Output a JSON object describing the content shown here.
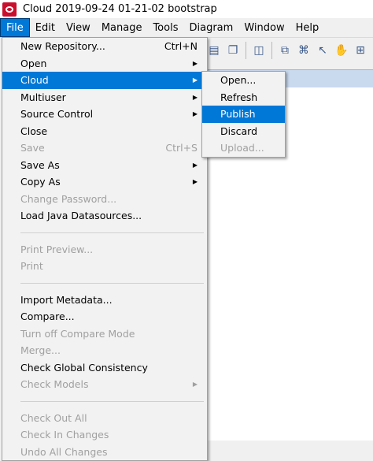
{
  "window": {
    "title": "Cloud 2019-09-24 01-21-02 bootstrap"
  },
  "menubar": {
    "items": [
      "File",
      "Edit",
      "View",
      "Manage",
      "Tools",
      "Diagram",
      "Window",
      "Help"
    ]
  },
  "file_menu": {
    "new_repository": {
      "label": "New Repository...",
      "shortcut": "Ctrl+N"
    },
    "open": "Open",
    "cloud": "Cloud",
    "multiuser": "Multiuser",
    "source_control": "Source Control",
    "close": "Close",
    "save": {
      "label": "Save",
      "shortcut": "Ctrl+S"
    },
    "save_as": "Save As",
    "copy_as": "Copy As",
    "change_password": "Change Password...",
    "load_java": "Load Java Datasources...",
    "print_preview": "Print Preview...",
    "print": "Print",
    "import_metadata": "Import Metadata...",
    "compare": "Compare...",
    "turn_off_compare": "Turn off Compare Mode",
    "merge": "Merge...",
    "check_global": "Check Global Consistency",
    "check_models": "Check Models",
    "check_out_all": "Check Out All",
    "check_in_changes": "Check In Changes",
    "undo_all_changes": "Undo All Changes"
  },
  "cloud_menu": {
    "open": "Open...",
    "refresh": "Refresh",
    "publish": "Publish",
    "discard": "Discard",
    "upload": "Upload..."
  },
  "colors": {
    "highlight": "#0078d7",
    "disabled_text": "#a0a0a0"
  }
}
